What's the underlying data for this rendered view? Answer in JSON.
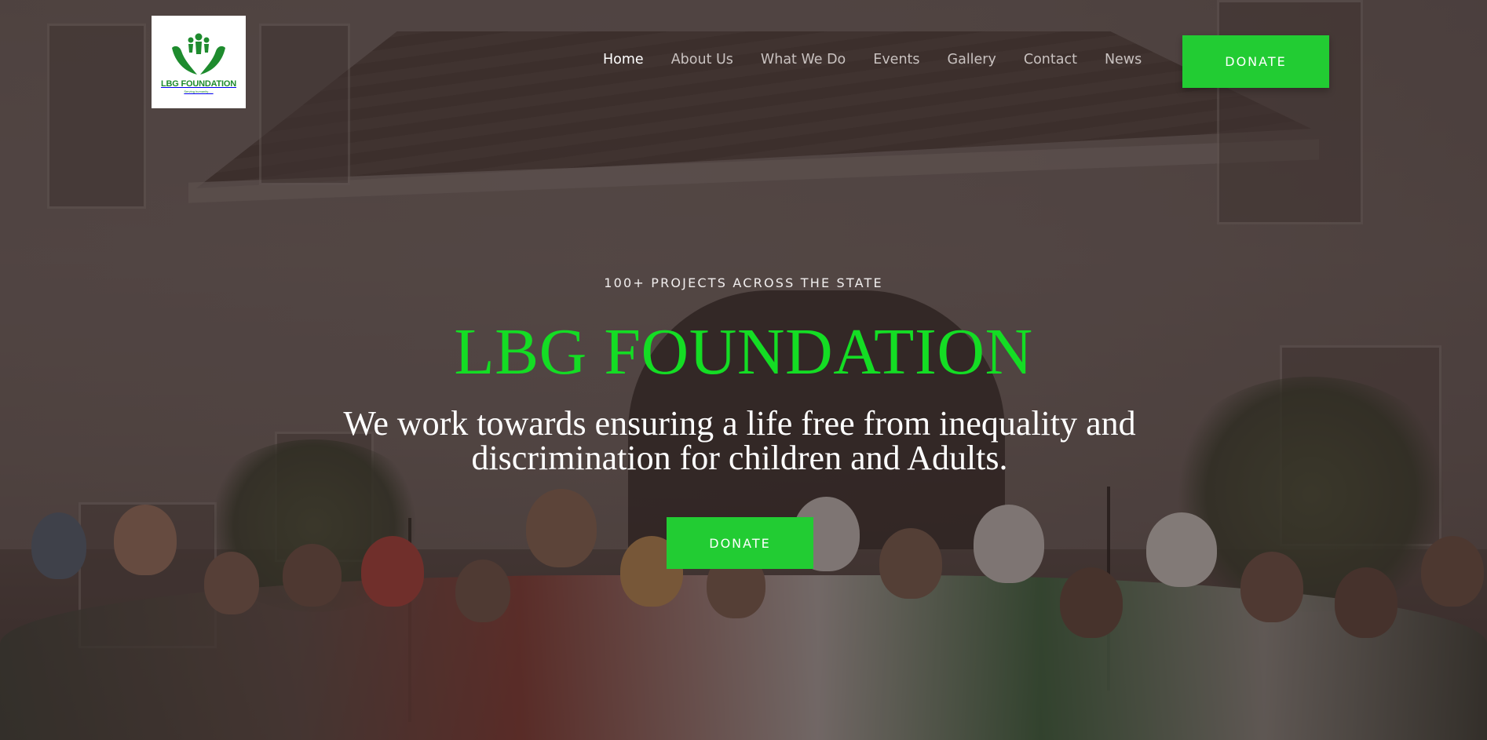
{
  "brand": {
    "logo_text": "LBG FOUNDATION",
    "logo_tagline": "Serving humanity......",
    "primary_color": "#22cc33",
    "logo_color": "#1e8b2e"
  },
  "nav": {
    "items": [
      {
        "label": "Home",
        "active": true
      },
      {
        "label": "About Us",
        "active": false
      },
      {
        "label": "What We Do",
        "active": false
      },
      {
        "label": "Events",
        "active": false
      },
      {
        "label": "Gallery",
        "active": false
      },
      {
        "label": "Contact",
        "active": false
      },
      {
        "label": "News",
        "active": false
      }
    ],
    "donate_label": "DONATE"
  },
  "hero": {
    "kicker": "100+ PROJECTS ACROSS THE STATE",
    "title": "LBG FOUNDATION",
    "subtitle": "We work towards ensuring a life free from inequality and discrimination for children and Adults.",
    "donate_label": "DONATE",
    "background_icon": "group-photo-of-children-and-adults-in-front-of-building"
  }
}
